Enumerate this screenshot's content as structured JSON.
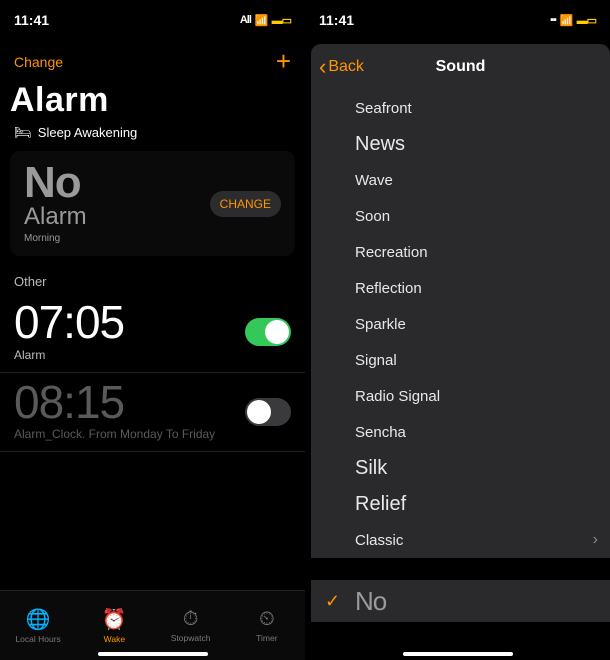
{
  "left": {
    "status": {
      "time": "11:41",
      "carrier": "All"
    },
    "topbar": {
      "change": "Change"
    },
    "title": "Alarm",
    "sleep_label": "Sleep Awakening",
    "card": {
      "line1": "No",
      "line2": "Alarm",
      "line3": "Morning",
      "change": "CHANGE"
    },
    "other_label": "Other",
    "alarms": [
      {
        "time": "07:05",
        "label": "Alarm",
        "on": true
      },
      {
        "time": "08:15",
        "label": "Alarm_Clock. From Monday To Friday",
        "on": false
      }
    ],
    "tabs": [
      {
        "icon": "🌐",
        "label": "Local Hours"
      },
      {
        "icon": "⏰",
        "label": "Wake"
      },
      {
        "icon": "⏱",
        "label": "Stopwatch"
      },
      {
        "icon": "⏲",
        "label": "Timer"
      }
    ]
  },
  "right": {
    "status": {
      "time": "11:41"
    },
    "nav": {
      "back": "Back",
      "title": "Sound"
    },
    "sounds": [
      "Seafront",
      "News",
      "Wave",
      "Soon",
      "Recreation",
      "Reflection",
      "Sparkle",
      "Signal",
      "Radio Signal",
      "Sencha",
      "Silk",
      "Relief",
      "Classic"
    ],
    "selected": "No"
  }
}
